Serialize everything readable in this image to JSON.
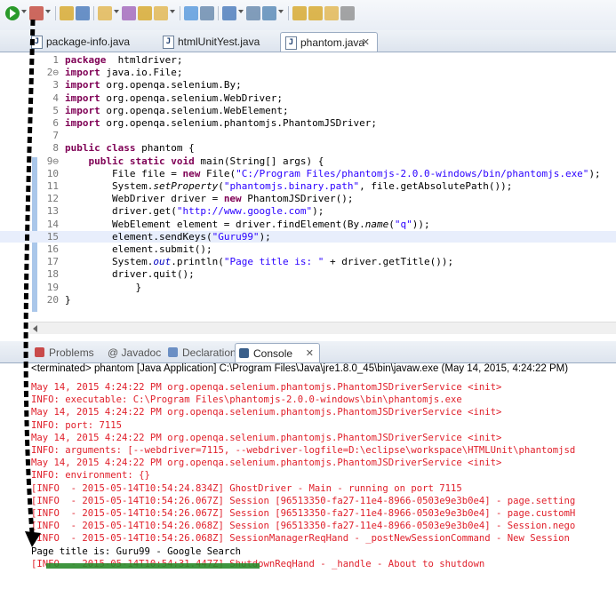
{
  "toolbar": {
    "icons": [
      "run-icon",
      "debug-icon",
      "new-package-icon",
      "new-class-icon",
      "open-folder-icon",
      "pencil-icon",
      "open-file-icon",
      "search-icon",
      "toggle-edit-icon",
      "pilcrow-icon",
      "show-whitespace-icon",
      "block-select-icon",
      "annotation-next-icon",
      "annotation-prev-icon",
      "back-icon",
      "forward-icon",
      "dropdown-icon"
    ]
  },
  "editor_tabs": [
    {
      "label": "package-info.java",
      "active": false
    },
    {
      "label": "htmlUnitYest.java",
      "active": false
    },
    {
      "label": "phantom.java",
      "active": true,
      "close": "✕"
    }
  ],
  "code": [
    {
      "n": "1",
      "t": [
        [
          "kw",
          "package"
        ],
        [
          "",
          "  htmldriver;"
        ]
      ]
    },
    {
      "n": "2⊖",
      "t": [
        [
          "kw",
          "import"
        ],
        [
          "",
          " java.io.File;"
        ]
      ]
    },
    {
      "n": "3",
      "t": [
        [
          "kw",
          "import"
        ],
        [
          "",
          " org.openqa.selenium.By;"
        ]
      ]
    },
    {
      "n": "4",
      "t": [
        [
          "kw",
          "import"
        ],
        [
          "",
          " org.openqa.selenium.WebDriver;"
        ]
      ]
    },
    {
      "n": "5",
      "t": [
        [
          "kw",
          "import"
        ],
        [
          "",
          " org.openqa.selenium.WebElement;"
        ]
      ]
    },
    {
      "n": "6",
      "t": [
        [
          "kw",
          "import"
        ],
        [
          "",
          " org.openqa.selenium.phantomjs.PhantomJSDriver;"
        ]
      ]
    },
    {
      "n": "7",
      "t": []
    },
    {
      "n": "8",
      "t": [
        [
          "kw",
          "public class"
        ],
        [
          "",
          " phantom {"
        ]
      ]
    },
    {
      "n": "9⊖",
      "t": [
        [
          "",
          "    "
        ],
        [
          "kw",
          "public static void"
        ],
        [
          "",
          " main(String[] args) {"
        ]
      ]
    },
    {
      "n": "10",
      "t": [
        [
          "",
          "        File file = "
        ],
        [
          "kw",
          "new"
        ],
        [
          "",
          " File("
        ],
        [
          "str",
          "\"C:/Program Files/phantomjs-2.0.0-windows/bin/phantomjs.exe\""
        ],
        [
          "",
          ");"
        ]
      ]
    },
    {
      "n": "11",
      "t": [
        [
          "",
          "        System."
        ],
        [
          "it",
          "setProperty"
        ],
        [
          "",
          "("
        ],
        [
          "str",
          "\"phantomjs.binary.path\""
        ],
        [
          "",
          ", file.getAbsolutePath());"
        ]
      ]
    },
    {
      "n": "12",
      "t": [
        [
          "",
          "        WebDriver driver = "
        ],
        [
          "kw",
          "new"
        ],
        [
          "",
          " PhantomJSDriver();"
        ]
      ]
    },
    {
      "n": "13",
      "t": [
        [
          "",
          "        driver.get("
        ],
        [
          "str",
          "\"http://www.google.com\""
        ],
        [
          "",
          ");"
        ]
      ]
    },
    {
      "n": "14",
      "t": [
        [
          "",
          "        WebElement element = driver.findElement(By."
        ],
        [
          "it",
          "name"
        ],
        [
          "",
          "("
        ],
        [
          "str",
          "\"q\""
        ],
        [
          "",
          "));"
        ]
      ]
    },
    {
      "n": "15",
      "t": [
        [
          "",
          "        element.sendKeys("
        ],
        [
          "str",
          "\"Guru99\""
        ],
        [
          "",
          ");"
        ]
      ],
      "hl": true
    },
    {
      "n": "16",
      "t": [
        [
          "",
          "        element.submit();"
        ]
      ]
    },
    {
      "n": "17",
      "t": [
        [
          "",
          "        System."
        ],
        [
          "fld",
          "out"
        ],
        [
          "",
          ".println("
        ],
        [
          "str",
          "\"Page title is: \""
        ],
        [
          "",
          " + driver.getTitle());"
        ]
      ]
    },
    {
      "n": "18",
      "t": [
        [
          "",
          "        driver.quit();"
        ]
      ]
    },
    {
      "n": "19",
      "t": [
        [
          "",
          "            }"
        ]
      ]
    },
    {
      "n": "20",
      "t": [
        [
          "",
          "}"
        ]
      ]
    }
  ],
  "view_tabs": [
    {
      "label": "Problems",
      "icon": "problems-icon"
    },
    {
      "label": "@ Javadoc",
      "icon": ""
    },
    {
      "label": "Declaration",
      "icon": "declaration-icon"
    },
    {
      "label": "Console",
      "icon": "console-icon",
      "active": true,
      "close": "✕"
    }
  ],
  "terminated": "<terminated> phantom [Java Application] C:\\Program Files\\Java\\jre1.8.0_45\\bin\\javaw.exe (May 14, 2015, 4:24:22 PM)",
  "console": [
    {
      "t": "May 14, 2015 4:24:22 PM org.openqa.selenium.phantomjs.PhantomJSDriverService <init>",
      "c": "red"
    },
    {
      "t": "INFO: executable: C:\\Program Files\\phantomjs-2.0.0-windows\\bin\\phantomjs.exe",
      "c": "red"
    },
    {
      "t": "May 14, 2015 4:24:22 PM org.openqa.selenium.phantomjs.PhantomJSDriverService <init>",
      "c": "red"
    },
    {
      "t": "INFO: port: 7115",
      "c": "red"
    },
    {
      "t": "May 14, 2015 4:24:22 PM org.openqa.selenium.phantomjs.PhantomJSDriverService <init>",
      "c": "red"
    },
    {
      "t": "INFO: arguments: [--webdriver=7115, --webdriver-logfile=D:\\eclipse\\workspace\\HTMLUnit\\phantomjsd",
      "c": "red"
    },
    {
      "t": "May 14, 2015 4:24:22 PM org.openqa.selenium.phantomjs.PhantomJSDriverService <init>",
      "c": "red"
    },
    {
      "t": "INFO: environment: {}",
      "c": "red"
    },
    {
      "t": "[INFO  - 2015-05-14T10:54:24.834Z] GhostDriver - Main - running on port 7115",
      "c": "red"
    },
    {
      "t": "[INFO  - 2015-05-14T10:54:26.067Z] Session [96513350-fa27-11e4-8966-0503e9e3b0e4] - page.setting",
      "c": "red"
    },
    {
      "t": "[INFO  - 2015-05-14T10:54:26.067Z] Session [96513350-fa27-11e4-8966-0503e9e3b0e4] - page.customH",
      "c": "red"
    },
    {
      "t": "[INFO  - 2015-05-14T10:54:26.068Z] Session [96513350-fa27-11e4-8966-0503e9e3b0e4] - Session.nego",
      "c": "red"
    },
    {
      "t": "[INFO  - 2015-05-14T10:54:26.068Z] SessionManagerReqHand - _postNewSessionCommand - New Session",
      "c": "red"
    },
    {
      "t": "Page title is: Guru99 - Google Search",
      "c": "black"
    },
    {
      "t": "[INFO  - 2015-05-14T10:54:31.447Z] ShutdownReqHand - _handle - About to shutdown",
      "c": "red"
    }
  ],
  "colors": {
    "keyword": "#7f0055",
    "string": "#2a00ff",
    "console_err": "#e0202b",
    "arrow": "#000000",
    "highlight_green": "#2a8a2a"
  }
}
